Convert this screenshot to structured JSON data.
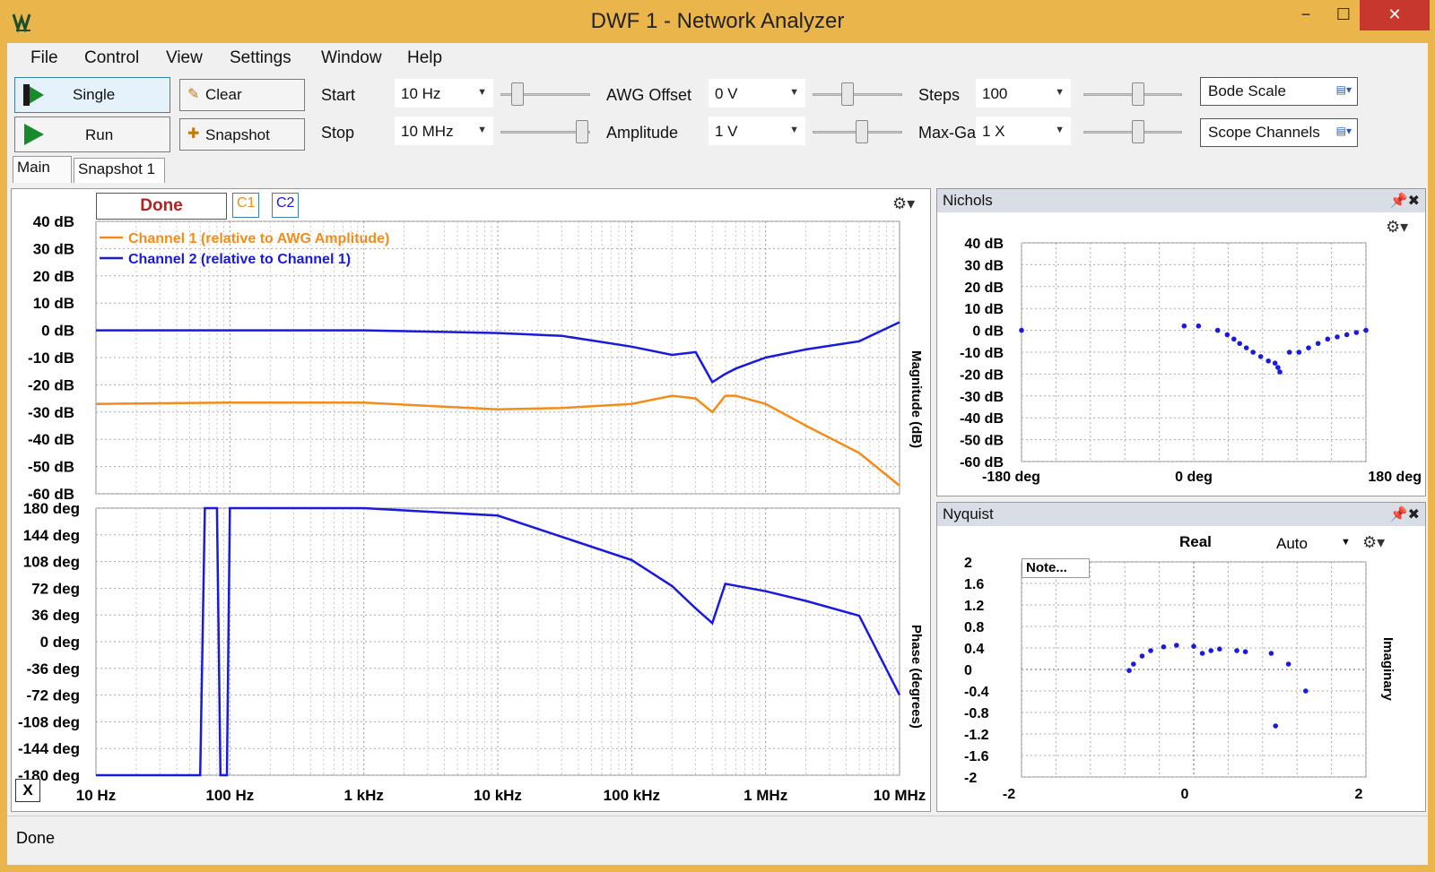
{
  "window": {
    "title": "DWF 1 - Network Analyzer",
    "minimize": "−",
    "maximize": "☐",
    "close": "✕"
  },
  "menu": [
    "File",
    "Control",
    "View",
    "Settings",
    "Window",
    "Help"
  ],
  "toolbar": {
    "single_label": "Single",
    "run_label": "Run",
    "clear_label": "Clear",
    "snapshot_label": "Snapshot",
    "start_label": "Start",
    "start_value": "10 Hz",
    "stop_label": "Stop",
    "stop_value": "10 MHz",
    "awg_offset_label": "AWG Offset",
    "awg_offset_value": "0 V",
    "amplitude_label": "Amplitude",
    "amplitude_value": "1 V",
    "steps_label": "Steps",
    "steps_value": "100",
    "max_gain_label": "Max-Gain",
    "max_gain_value": "1 X",
    "bode_scale_label": "Bode Scale",
    "scope_channels_label": "Scope Channels"
  },
  "tabs": [
    "Main",
    "Snapshot 1"
  ],
  "bode": {
    "status": "Done",
    "c1_label": "C1",
    "c2_label": "C2",
    "x_button": "X",
    "mag_axis_label": "Magnitude (dB)",
    "phase_axis_label": "Phase (degrees)",
    "mag_ticks": [
      "40 dB",
      "30 dB",
      "20 dB",
      "10 dB",
      "0 dB",
      "-10 dB",
      "-20 dB",
      "-30 dB",
      "-40 dB",
      "-50 dB",
      "-60 dB"
    ],
    "phase_ticks": [
      "180 deg",
      "144 deg",
      "108 deg",
      "72 deg",
      "36 deg",
      "0 deg",
      "-36 deg",
      "-72 deg",
      "-108 deg",
      "-144 deg",
      "-180 deg"
    ],
    "freq_ticks": [
      "10 Hz",
      "100 Hz",
      "1 kHz",
      "10 kHz",
      "100 kHz",
      "1 MHz",
      "10 MHz"
    ],
    "legend": [
      {
        "name": "Channel 1 (relative to AWG Amplitude)",
        "color": "#f28c1a"
      },
      {
        "name": "Channel 2 (relative to Channel 1)",
        "color": "#1a1adc"
      }
    ]
  },
  "nichols": {
    "title": "Nichols",
    "y_ticks": [
      "40 dB",
      "30 dB",
      "20 dB",
      "10 dB",
      "0 dB",
      "-10 dB",
      "-20 dB",
      "-30 dB",
      "-40 dB",
      "-50 dB",
      "-60 dB"
    ],
    "x_ticks": [
      "-180 deg",
      "0 deg",
      "180 deg"
    ]
  },
  "nyquist": {
    "title": "Nyquist",
    "x_label": "Real",
    "y_label": "Imaginary",
    "auto_label": "Auto",
    "note_label": "Note...",
    "y_ticks": [
      "2",
      "1.6",
      "1.2",
      "0.8",
      "0.4",
      "0",
      "-0.4",
      "-0.8",
      "-1.2",
      "-1.6",
      "-2"
    ],
    "x_ticks": [
      "-2",
      "0",
      "2"
    ]
  },
  "status_text": "Done",
  "chart_data": [
    {
      "type": "line",
      "title": "",
      "xlabel": "",
      "ylabel": "Magnitude (dB)",
      "x_scale": "log",
      "x": [
        10,
        100,
        1000,
        10000,
        30000,
        100000,
        200000,
        300000,
        400000,
        500000,
        600000,
        1000000,
        2000000,
        5000000,
        10000000
      ],
      "series": [
        {
          "name": "Channel 1 (relative to AWG Amplitude)",
          "values": [
            -27,
            -26.5,
            -26.5,
            -29,
            -28.5,
            -27,
            -24,
            -25,
            -30,
            -24,
            -24,
            -27,
            -35,
            -45,
            -57
          ]
        },
        {
          "name": "Channel 2 (relative to Channel 1)",
          "values": [
            0,
            0,
            0,
            -1,
            -2,
            -6,
            -9,
            -8,
            -19,
            -16,
            -14,
            -10,
            -7,
            -4,
            3
          ]
        }
      ],
      "ylim": [
        -60,
        40
      ]
    },
    {
      "type": "line",
      "title": "",
      "xlabel": "",
      "ylabel": "Phase (degrees)",
      "x_scale": "log",
      "x": [
        10,
        60,
        65,
        80,
        85,
        95,
        100,
        1000,
        10000,
        100000,
        200000,
        300000,
        400000,
        500000,
        1000000,
        2000000,
        5000000,
        10000000
      ],
      "series": [
        {
          "name": "Channel 2 (relative to Channel 1)",
          "values": [
            -180,
            -180,
            180,
            180,
            -180,
            -180,
            180,
            180,
            170,
            110,
            75,
            45,
            25,
            78,
            68,
            55,
            35,
            -72
          ]
        }
      ],
      "ylim": [
        -180,
        180
      ]
    },
    {
      "type": "scatter",
      "title": "Nichols",
      "xlabel": "",
      "ylabel": "",
      "x": [
        -180,
        -10,
        5,
        25,
        35,
        42,
        48,
        55,
        62,
        70,
        78,
        85,
        88,
        90,
        100,
        110,
        120,
        130,
        140,
        150,
        160,
        170,
        180
      ],
      "series": [
        {
          "name": "",
          "values": [
            0,
            2,
            2,
            0,
            -2,
            -4,
            -6,
            -8,
            -10,
            -12,
            -14,
            -15,
            -17,
            -19,
            -10,
            -10,
            -8,
            -6,
            -4,
            -3,
            -2,
            -1,
            0
          ]
        }
      ],
      "xlim": [
        -180,
        180
      ],
      "ylim": [
        -60,
        40
      ]
    },
    {
      "type": "scatter",
      "title": "Nyquist",
      "xlabel": "Real",
      "ylabel": "Imaginary",
      "x": [
        -0.75,
        -0.7,
        -0.6,
        -0.5,
        -0.35,
        -0.2,
        0,
        0.1,
        0.2,
        0.3,
        0.5,
        0.6,
        0.9,
        1.1,
        1.3,
        0.95
      ],
      "series": [
        {
          "name": "",
          "values": [
            -0.02,
            0.1,
            0.25,
            0.35,
            0.42,
            0.45,
            0.43,
            0.3,
            0.35,
            0.38,
            0.35,
            0.33,
            0.3,
            0.1,
            -0.4,
            -1.05
          ]
        }
      ],
      "xlim": [
        -2,
        2
      ],
      "ylim": [
        -2,
        2
      ]
    }
  ]
}
